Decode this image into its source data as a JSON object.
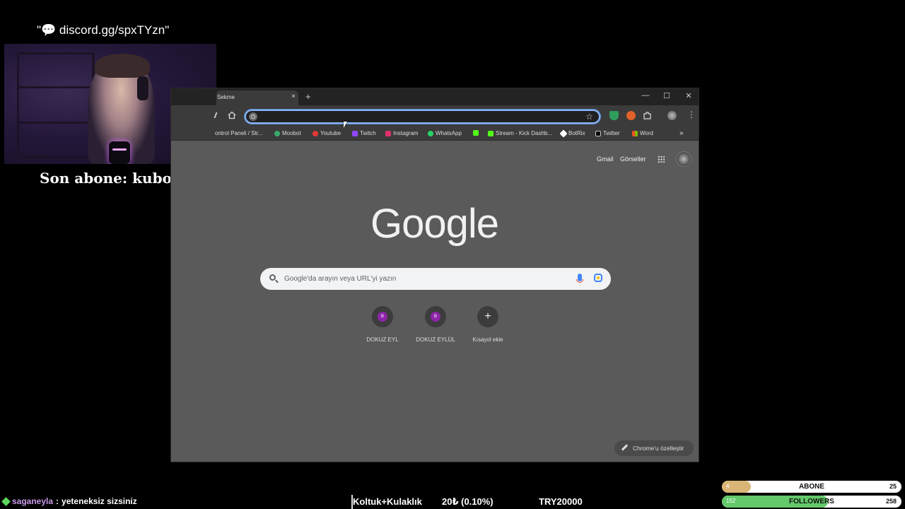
{
  "overlay": {
    "discord_text": "\"💬 discord.gg/spxTYzn\"",
    "last_sub": "Son abone: kubossx"
  },
  "browser": {
    "tab_title": "Sekme",
    "tab_close": "×",
    "new_tab": "+",
    "window_controls": {
      "minimize": "—",
      "maximize": "☐",
      "close": "✕"
    },
    "omnibox_value": "",
    "bookmarks": [
      {
        "label": "ontrol Paneli / Str...",
        "icon_color": "#7f7f7f"
      },
      {
        "label": "Moobot",
        "icon_color": "#3aa86b"
      },
      {
        "label": "Youtube",
        "icon_color": "#e53935"
      },
      {
        "label": "Twitch",
        "icon_color": "#9146ff"
      },
      {
        "label": "Instagram",
        "icon_color": "#e1306c"
      },
      {
        "label": "WhatsApp",
        "icon_color": "#25d366"
      },
      {
        "label": "",
        "icon_color": "#53fc18"
      },
      {
        "label": "Stream - Kick Dashb...",
        "icon_color": "#53fc18"
      },
      {
        "label": "BotRix",
        "icon_color": "#ffffff"
      },
      {
        "label": "Twitter",
        "icon_color": "#000000"
      },
      {
        "label": "Word",
        "icon_color": "#2b579a"
      }
    ],
    "bookmarks_more": "»",
    "header_links": {
      "gmail": "Gmail",
      "images": "Görseller"
    },
    "logo": "Google",
    "search_placeholder": "Google'da arayın veya URL'yi yazın",
    "shortcuts": [
      {
        "label": "DOKUZ EYL",
        "initial": "B"
      },
      {
        "label": "DOKUZ EYLÜL",
        "initial": "B"
      },
      {
        "label": "Kısayol ekle",
        "initial": "+"
      }
    ],
    "customize_label": "Chrome'u özelleştir"
  },
  "ticker": {
    "chat_user": "saganeyla",
    "chat_sep": ":",
    "chat_message": "yeteneksiz sizsiniz",
    "item1": "Koltuk+Kulaklık",
    "item2": "20₺ (0.10%)",
    "item3": "TRY20000"
  },
  "goals": {
    "subs": {
      "current": "4",
      "label": "ABONE",
      "target": "25",
      "progress": 0.16
    },
    "followers": {
      "current": "152",
      "label": "FOLLOWERS",
      "target": "258",
      "progress": 0.59
    }
  },
  "colors": {
    "subs_fill": "#d9b676",
    "followers_fill": "#63c96a",
    "omnibox_focus": "#8ab4f8",
    "shortcut_accent": "#8e24aa"
  }
}
